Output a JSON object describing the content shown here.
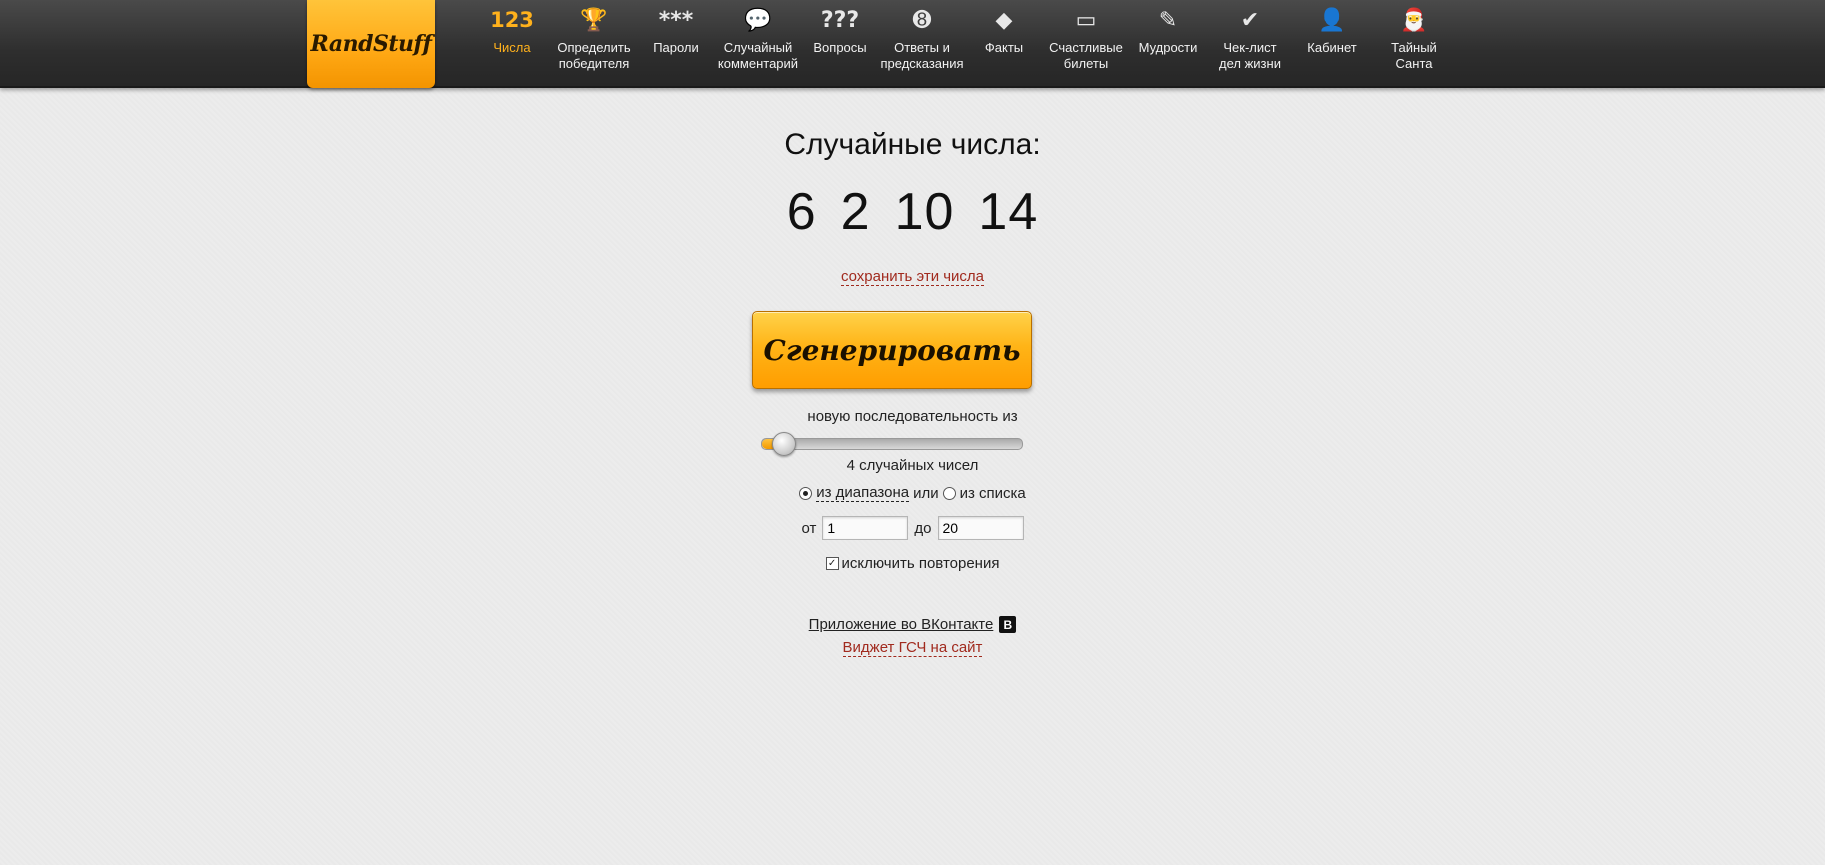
{
  "logo": {
    "text": "RandStuff"
  },
  "nav": [
    {
      "label_lines": [
        "Числа"
      ],
      "icon": "123",
      "icon_name": "numbers-icon",
      "active": true
    },
    {
      "label_lines": [
        "Определить",
        "победителя"
      ],
      "icon": "🏆",
      "icon_name": "trophy-vk-icon",
      "active": false
    },
    {
      "label_lines": [
        "Пароли"
      ],
      "icon": "***",
      "icon_name": "password-icon",
      "active": false
    },
    {
      "label_lines": [
        "Случайный",
        "комментарий"
      ],
      "icon": "💬",
      "icon_name": "comment-icon",
      "active": false
    },
    {
      "label_lines": [
        "Вопросы"
      ],
      "icon": "???",
      "icon_name": "questions-icon",
      "active": false
    },
    {
      "label_lines": [
        "Ответы и",
        "предсказания"
      ],
      "icon": "➑",
      "icon_name": "magic-ball-icon",
      "active": false
    },
    {
      "label_lines": [
        "Факты"
      ],
      "icon": "◆",
      "icon_name": "fact-exclamation-icon",
      "active": false
    },
    {
      "label_lines": [
        "Счастливые",
        "билеты"
      ],
      "icon": "▭",
      "icon_name": "ticket-icon",
      "active": false
    },
    {
      "label_lines": [
        "Мудрости"
      ],
      "icon": "✎",
      "icon_name": "scroll-icon",
      "active": false
    },
    {
      "label_lines": [
        "Чек-лист",
        "дел жизни"
      ],
      "icon": "✔",
      "icon_name": "checklist-badge-icon",
      "active": false
    },
    {
      "label_lines": [
        "Кабинет"
      ],
      "icon": "👤",
      "icon_name": "user-icon",
      "active": false
    },
    {
      "label_lines": [
        "Тайный",
        "Санта"
      ],
      "icon": "🎅",
      "icon_name": "santa-icon",
      "active": false
    }
  ],
  "main": {
    "title": "Случайные числа:",
    "numbers": [
      "6",
      "2",
      "10",
      "14"
    ],
    "save_link": "сохранить эти числа",
    "generate_button": "Сгенерировать",
    "sequence_label": "новую последовательность из",
    "slider": {
      "value": 4,
      "min": 1,
      "max": 100
    },
    "count_label": "4 случайных чисел",
    "radio": {
      "from_range": "из диапазона",
      "or": "или",
      "from_list": "из списка",
      "selected": "range"
    },
    "range": {
      "from_label": "от",
      "from_value": "1",
      "to_label": "до",
      "to_value": "20"
    },
    "exclude_repeats": {
      "label": "исключить повторения",
      "checked": true
    },
    "vk_app_link": "Приложение во ВКонтакте",
    "vk_badge": "B",
    "widget_link": "Виджет ГСЧ на сайт"
  }
}
